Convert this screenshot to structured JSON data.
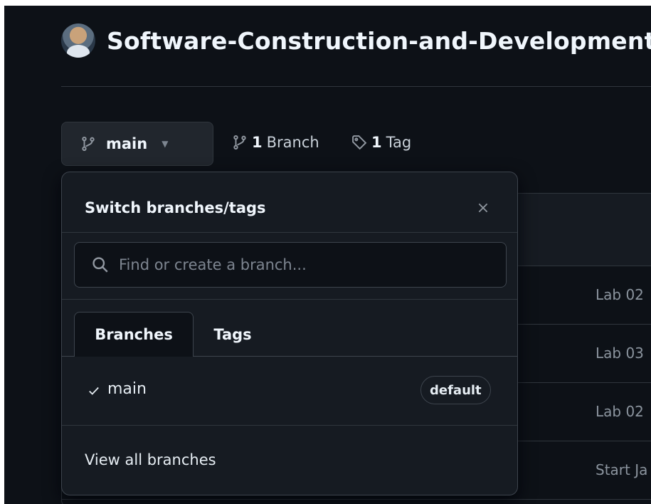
{
  "repo": {
    "title": "Software-Construction-and-Development"
  },
  "toolbar": {
    "current_branch": "main",
    "branch_count": "1",
    "branch_label": "Branch",
    "tag_count": "1",
    "tag_label": "Tag"
  },
  "dropdown": {
    "title": "Switch branches/tags",
    "search_placeholder": "Find or create a branch...",
    "tabs": [
      {
        "label": "Branches",
        "active": true
      },
      {
        "label": "Tags",
        "active": false
      }
    ],
    "branches": [
      {
        "name": "main",
        "selected": true,
        "badge": "default"
      }
    ],
    "footer_link": "View all branches"
  },
  "files": {
    "rows": [
      {
        "message": "Lab 02"
      },
      {
        "message": "Lab 03"
      },
      {
        "message": "Lab 02"
      },
      {
        "message": "Start Ja"
      }
    ]
  },
  "colors": {
    "background": "#0d1117",
    "overlay": "#161b22",
    "border": "#30363d",
    "text": "#e6edf3",
    "muted": "#7d8590"
  },
  "icons": {
    "branch": "git-branch-icon",
    "tag": "tag-icon",
    "search": "search-icon",
    "close": "close-icon",
    "check": "check-icon",
    "caret": "triangle-down-icon"
  }
}
